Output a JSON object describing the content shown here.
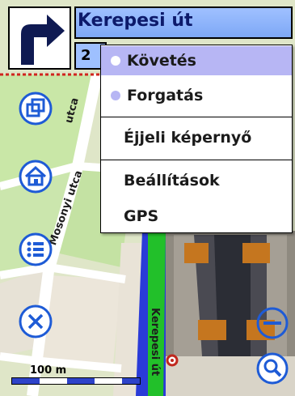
{
  "header": {
    "street_name": "Kerepesi út",
    "distance_partial": "2"
  },
  "menu": {
    "items": [
      {
        "label": "Követés",
        "type": "radio",
        "selected": true
      },
      {
        "label": "Forgatás",
        "type": "radio",
        "selected": false
      },
      {
        "label": "Éjjeli képernyő",
        "type": "command"
      },
      {
        "label": "Beállítások",
        "type": "command"
      },
      {
        "label": "GPS",
        "type": "command"
      }
    ]
  },
  "map": {
    "street_labels": {
      "a": "Mosonyi utca",
      "b": "Kerepesi út",
      "c": "utca"
    }
  },
  "scale": {
    "label": "100 m"
  },
  "icons": {
    "turn": "turn-right-arrow-icon",
    "side": [
      "windows-icon",
      "home-icon",
      "list-icon",
      "close-icon"
    ],
    "zoom": [
      "zoom-out-icon",
      "search-icon"
    ]
  },
  "colors": {
    "menu_highlight": "#b7b6f4",
    "route_green": "#22c02a",
    "road_blue": "#2a3bd8",
    "button_blue": "#1e5bd6"
  }
}
